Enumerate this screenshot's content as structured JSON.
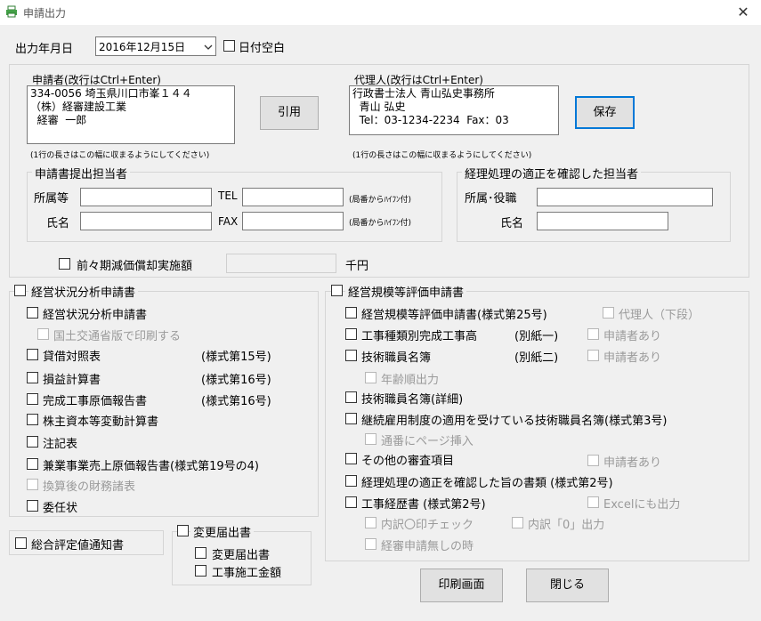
{
  "window": {
    "title": "申請出力",
    "close_glyph": "✕"
  },
  "date": {
    "label": "出力年月日",
    "value": "2016年12月15日",
    "blank_label": "日付空白"
  },
  "applicant": {
    "title": "申請者(改行はCtrl+Enter)",
    "text": "334-0056 埼玉県川口市峯１４４\n（株）経審建設工業\n  経審  一郎",
    "note": "(1行の長さはこの幅に収まるようにしてください)",
    "quote_button": "引用"
  },
  "agent": {
    "title": "代理人(改行はCtrl+Enter)",
    "text": "行政書士法人 青山弘史事務所\n  青山 弘史\n  Tel：03-1234-2234  Fax：03",
    "note": "(1行の長さはこの幅に収まるようにしてください)",
    "save_button": "保存"
  },
  "submitter": {
    "title": "申請書提出担当者",
    "dept_label": "所属等",
    "name_label": "氏名",
    "tel_label": "TEL",
    "fax_label": "FAX",
    "area_note_1": "(局番からﾊｲﾌﾝ付)",
    "area_note_2": "(局番からﾊｲﾌﾝ付)"
  },
  "accounting": {
    "title": "経理処理の適正を確認した担当者",
    "dept_label": "所属･役職",
    "name_label": "氏名"
  },
  "depreciation": {
    "label": "前々期減価償却実施額",
    "unit": "千円"
  },
  "left_group": {
    "title": "経営状況分析申請書",
    "items": {
      "analysis": "経営状況分析申請書",
      "mlit": "国土交通省版で印刷する",
      "balance": "貸借対照表",
      "balance_form": "(様式第15号)",
      "pl": "損益計算書",
      "pl_form": "(様式第16号)",
      "cost": "完成工事原価報告書",
      "cost_form": "(様式第16号)",
      "equity": "株主資本等変動計算書",
      "notes": "注記表",
      "side": "兼業事業売上原価報告書(様式第19号の4)",
      "converted": "換算後の財務諸表",
      "proxy": "委任状"
    }
  },
  "total_eval": {
    "label": "総合評定値通知書"
  },
  "change": {
    "title": "変更届出書",
    "item1": "変更届出書",
    "item2": "工事施工金額"
  },
  "right_group": {
    "title": "経営規模等評価申請書",
    "items": {
      "eval": "経営規模等評価申請書(様式第25号)",
      "eval_agent": "代理人（下段）",
      "kind": "工事種類別完成工事高",
      "kind_form": "(別紙一)",
      "kind_app": "申請者あり",
      "staff": "技術職員名簿",
      "staff_form": "(別紙二)",
      "staff_app": "申請者あり",
      "age": "年齢順出力",
      "staff_detail": "技術職員名簿(詳細)",
      "employment": "継続雇用制度の適用を受けている技術職員名簿(様式第3号)",
      "page": "通番にページ挿入",
      "other": "その他の審査項目",
      "other_app": "申請者あり",
      "proper": "経理処理の適正を確認した旨の書類 (様式第2号)",
      "history": "工事経歴書 (様式第2号)",
      "excel": "Excelにも出力",
      "check": "内訳〇印チェック",
      "zero": "内訳「0」出力",
      "none": "経審申請無しの時"
    }
  },
  "footer": {
    "print_button": "印刷画面",
    "close_button": "閉じる"
  },
  "colors": {
    "focus_border": "#0078d7",
    "disabled_text": "#9a9a9a",
    "background": "#f0f0f0"
  }
}
